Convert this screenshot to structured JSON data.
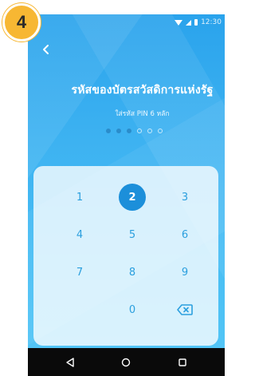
{
  "step_badge": {
    "number": "4"
  },
  "status_bar": {
    "time": "12:30"
  },
  "header": {
    "title": "รหัสของบัตรสวัสดิการแห่งรัฐ",
    "subtitle": "ใส่รหัส PIN 6 หลัก"
  },
  "pin": {
    "length": 6,
    "entered": 3
  },
  "keypad": {
    "keys": [
      "1",
      "2",
      "3",
      "4",
      "5",
      "6",
      "7",
      "8",
      "9",
      "0"
    ],
    "active_key": "2"
  },
  "colors": {
    "accent": "#1c8fda",
    "key_text": "#2b9fde",
    "badge": "#f7b733",
    "gradient_top": "#2aa3ec",
    "gradient_bottom": "#55c7f6"
  }
}
